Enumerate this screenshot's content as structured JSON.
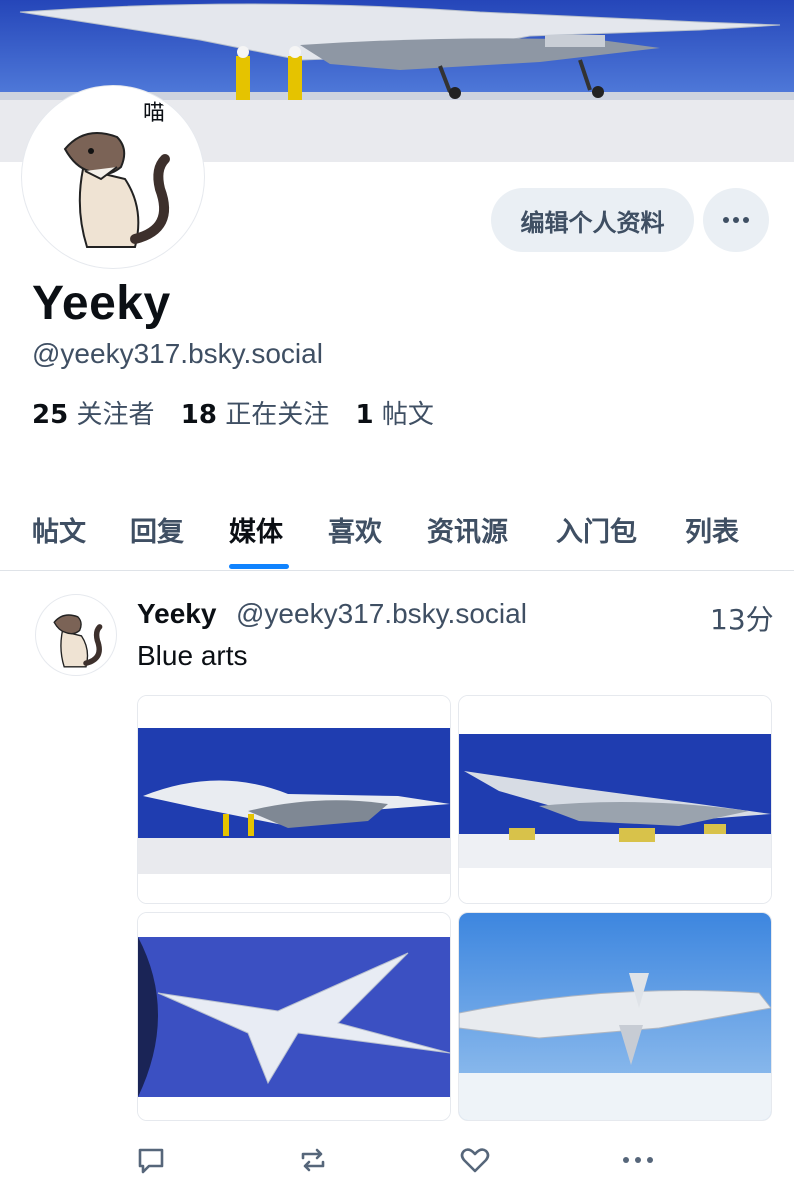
{
  "banner": {
    "description_icon": "airplane-banner-image"
  },
  "profile": {
    "avatar_icon": "cat-avatar",
    "avatar_text": "喵",
    "display_name": "Yeeky",
    "handle": "@yeeky317.bsky.social",
    "followers_count": "25",
    "followers_label": "关注者",
    "following_count": "18",
    "following_label": "正在关注",
    "posts_count": "1",
    "posts_label": "帖文",
    "edit_button": "编辑个人资料",
    "more_icon": "ellipsis-icon"
  },
  "tabs": [
    {
      "label": "帖文"
    },
    {
      "label": "回复"
    },
    {
      "label": "媒体",
      "active": true
    },
    {
      "label": "喜欢"
    },
    {
      "label": "资讯源"
    },
    {
      "label": "入门包"
    },
    {
      "label": "列表"
    }
  ],
  "post": {
    "author_name": "Yeeky",
    "author_handle": "@yeeky317.bsky.social",
    "time": "13分",
    "text": "Blue arts",
    "images": [
      "airplane-art-1",
      "airplane-art-2",
      "airplane-art-3",
      "airplane-art-4"
    ],
    "actions": [
      "reply-icon",
      "repost-icon",
      "like-icon",
      "more-icon"
    ]
  },
  "colors": {
    "accent": "#1083fe",
    "muted": "#3f4f63",
    "button_bg": "#eaeff4"
  }
}
